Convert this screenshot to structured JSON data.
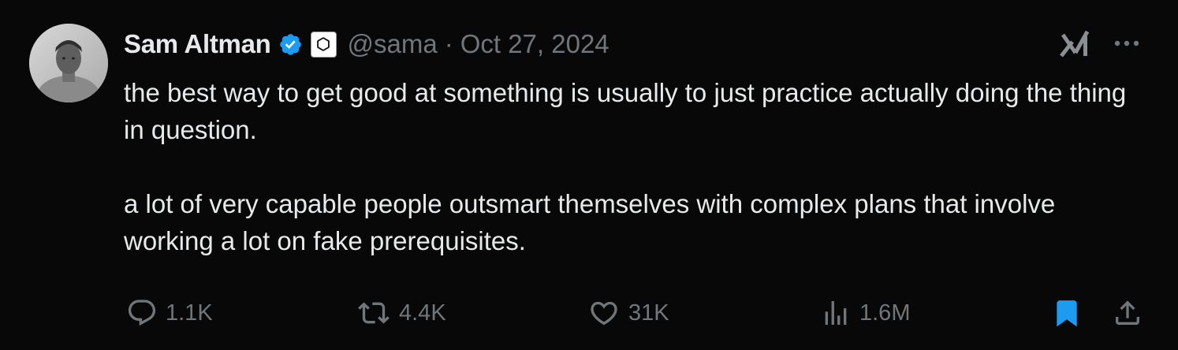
{
  "author": {
    "name": "Sam Altman",
    "handle": "@sama",
    "separator": "·",
    "date": "Oct 27, 2024",
    "verified_badge": "verified-checkmark-icon",
    "affiliation_badge": "openai-logo-icon"
  },
  "post": {
    "paragraph_1": "the best way to get good at something is usually to just practice actually doing the thing in question.",
    "paragraph_2": "a lot of very capable people outsmart themselves with complex plans that involve working a lot on fake prerequisites."
  },
  "actions": {
    "replies": "1.1K",
    "reposts": "4.4K",
    "likes": "31K",
    "views": "1.6M",
    "bookmarked": true
  },
  "top_right": {
    "grok_icon": "grok-icon",
    "more_icon": "more-dots-icon"
  },
  "colors": {
    "background": "#080808",
    "text": "#e7e9ea",
    "muted": "#71767b",
    "accent": "#1d9bf0"
  }
}
